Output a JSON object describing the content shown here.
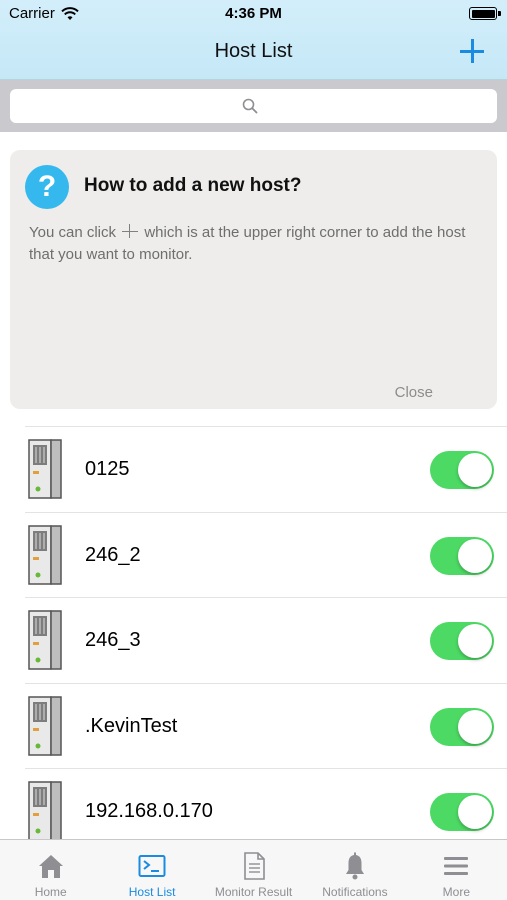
{
  "status_bar": {
    "carrier": "Carrier",
    "time": "4:36 PM"
  },
  "nav": {
    "title": "Host List",
    "add_icon": "plus-icon"
  },
  "search": {
    "placeholder": "",
    "icon": "search-icon"
  },
  "help_card": {
    "icon": "question-icon",
    "icon_glyph": "?",
    "title": "How to add a new host?",
    "text_before": "You can click",
    "text_after": "which is at the upper right corner to add the host that you want to monitor.",
    "close_label": "Close"
  },
  "hosts": [
    {
      "name": "0125",
      "enabled": true
    },
    {
      "name": "246_2",
      "enabled": true
    },
    {
      "name": "246_3",
      "enabled": true
    },
    {
      "name": ".KevinTest",
      "enabled": true
    },
    {
      "name": "192.168.0.170",
      "enabled": true
    }
  ],
  "tabs": [
    {
      "label": "Home",
      "icon": "home-icon",
      "active": false
    },
    {
      "label": "Host List",
      "icon": "terminal-icon",
      "active": true
    },
    {
      "label": "Monitor Result",
      "icon": "document-icon",
      "active": false
    },
    {
      "label": "Notifications",
      "icon": "bell-icon",
      "active": false
    },
    {
      "label": "More",
      "icon": "menu-icon",
      "active": false
    }
  ],
  "colors": {
    "accent": "#1a8be0",
    "toggle_on": "#4cd964",
    "header_bg": "#c5e8f7",
    "help_icon": "#34b8ed"
  }
}
